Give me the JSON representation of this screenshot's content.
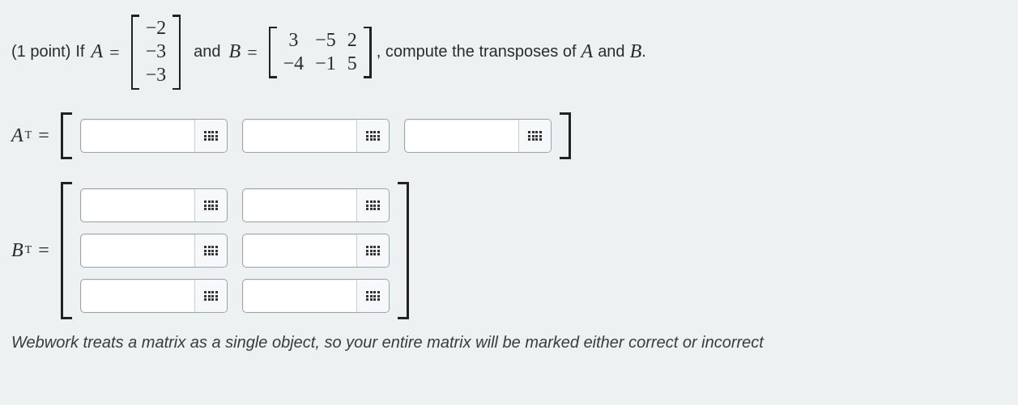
{
  "problem": {
    "points_label": "(1 point)",
    "if_text": "If",
    "var_A": "A",
    "eq": "=",
    "and_text": "and",
    "var_B": "B",
    "instruction_tail": ", compute the transposes of",
    "instruction_and": "and",
    "period": ".",
    "matrix_A": {
      "rows": 3,
      "cols": 1,
      "values": [
        "−2",
        "−3",
        "−3"
      ]
    },
    "matrix_B": {
      "rows": 2,
      "cols": 3,
      "values": [
        "3",
        "−5",
        "2",
        "−4",
        "−1",
        "5"
      ]
    }
  },
  "answers": {
    "AT_label_base": "A",
    "BT_label_base": "B",
    "transpose_sup": "T",
    "eq": "=",
    "AT": {
      "rows": 1,
      "cols": 3
    },
    "BT": {
      "rows": 3,
      "cols": 2
    }
  },
  "footer": {
    "text": "Webwork treats a matrix as a single object, so your entire matrix will be marked either correct or incorrect"
  },
  "chart_data": {
    "type": "table",
    "title": "Matrix definitions",
    "matrices": [
      {
        "name": "A",
        "rows": 3,
        "cols": 1,
        "data": [
          [
            -2
          ],
          [
            -3
          ],
          [
            -3
          ]
        ]
      },
      {
        "name": "B",
        "rows": 2,
        "cols": 3,
        "data": [
          [
            3,
            -5,
            2
          ],
          [
            -4,
            -1,
            5
          ]
        ]
      }
    ]
  }
}
